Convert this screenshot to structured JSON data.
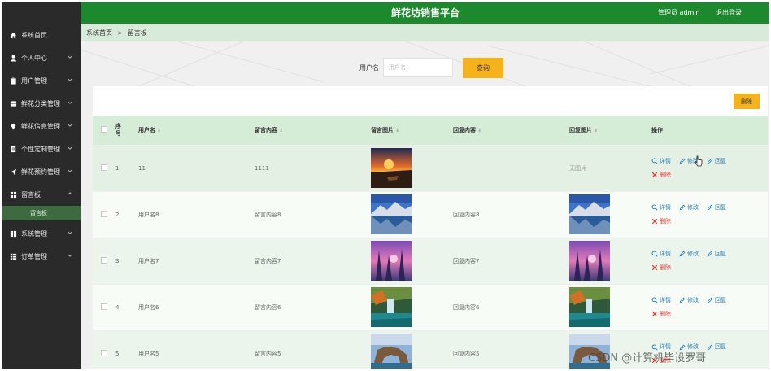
{
  "header": {
    "title": "鲜花坊销售平台",
    "admin_label": "管理员 admin",
    "logout_label": "退出登录"
  },
  "sidebar": {
    "items": [
      {
        "label": "系统首页",
        "icon": "home-icon",
        "chevron": false
      },
      {
        "label": "个人中心",
        "icon": "user-icon",
        "chevron": true
      },
      {
        "label": "用户管理",
        "icon": "clipboard-icon",
        "chevron": true
      },
      {
        "label": "鲜花分类管理",
        "icon": "list-icon",
        "chevron": true
      },
      {
        "label": "鲜花信息管理",
        "icon": "bulb-icon",
        "chevron": true
      },
      {
        "label": "个性定制管理",
        "icon": "doc-icon",
        "chevron": true
      },
      {
        "label": "鲜花预约管理",
        "icon": "send-icon",
        "chevron": true
      },
      {
        "label": "留言板",
        "icon": "grid-icon",
        "chevron": true,
        "open": true
      },
      {
        "label": "系统管理",
        "icon": "grid-icon",
        "chevron": true
      },
      {
        "label": "订单管理",
        "icon": "table-icon",
        "chevron": true
      }
    ],
    "subitem": "留言板"
  },
  "breadcrumb": {
    "home": "系统首页",
    "separator": ">",
    "current": "留言板"
  },
  "search": {
    "label": "用户名",
    "placeholder": "用户名",
    "value": "",
    "button": "查询"
  },
  "toolbar": {
    "delete_label": "删除"
  },
  "table": {
    "headers": {
      "index": "序号",
      "username": "用户名",
      "content": "留言内容",
      "image": "留言图片",
      "reply": "回复内容",
      "reply_image": "回复图片",
      "actions": "操作"
    },
    "rows": [
      {
        "index": "1",
        "username": "11",
        "content": "1111",
        "image": "sunset",
        "reply": "",
        "reply_image_text": "无图片",
        "reply_image": ""
      },
      {
        "index": "2",
        "username": "用户名8",
        "content": "留言内容8",
        "image": "lake",
        "reply": "回复内容8",
        "reply_image": "lake"
      },
      {
        "index": "3",
        "username": "用户名7",
        "content": "留言内容7",
        "image": "pinktrees",
        "reply": "回复内容7",
        "reply_image": "pinktrees"
      },
      {
        "index": "4",
        "username": "用户名6",
        "content": "留言内容6",
        "image": "waterfall",
        "reply": "回复内容6",
        "reply_image": "waterfall"
      },
      {
        "index": "5",
        "username": "用户名5",
        "content": "留言内容5",
        "image": "arch",
        "reply": "回复内容5",
        "reply_image": "arch"
      }
    ],
    "actions": {
      "detail": "详情",
      "edit": "修改",
      "reply": "回复",
      "delete": "删除"
    }
  },
  "watermark": "CSDN @计算机毕设罗哥",
  "colors": {
    "header": "#1c8a2c",
    "sidebar": "#2a2a2a",
    "accent_button": "#f5b21a",
    "link": "#2b7fb8",
    "danger": "#e53935"
  }
}
